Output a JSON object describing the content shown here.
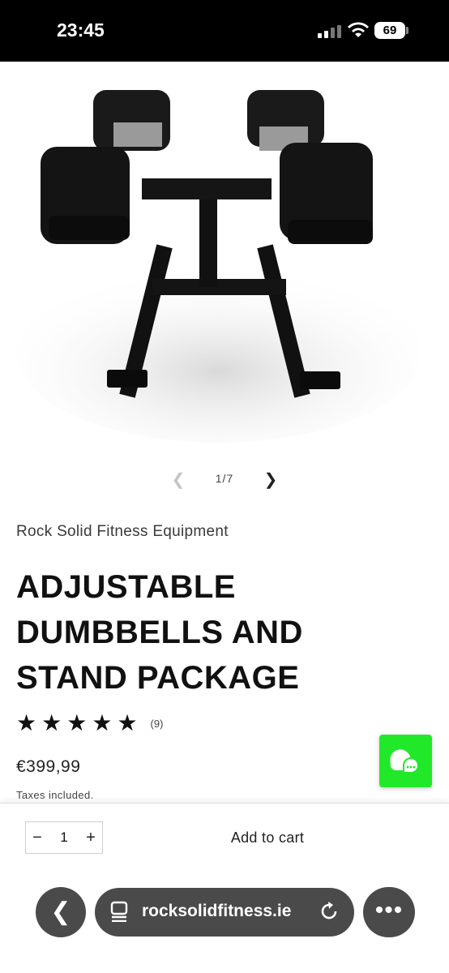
{
  "status_bar": {
    "time": "23:45",
    "battery_level": "69",
    "icons": [
      "signal-icon",
      "wifi-icon",
      "battery-icon"
    ]
  },
  "product": {
    "image_icon": "adjustable-dumbbells-on-stand-image",
    "gallery": {
      "counter": "1/7",
      "prev_icon": "chevron-left-icon",
      "next_icon": "chevron-right-icon"
    },
    "vendor": "Rock Solid Fitness Equipment",
    "title": "ADJUSTABLE DUMBBELLS AND STAND PACKAGE",
    "rating": {
      "stars": 5,
      "count": "(9)"
    },
    "price": "€399,99",
    "tax_note": "Taxes included."
  },
  "chat": {
    "icon": "chat-bubble-icon",
    "color": "#22e82a"
  },
  "buy_bar": {
    "quantity": "1",
    "minus_label": "−",
    "plus_label": "+",
    "add_to_cart": "Add to cart"
  },
  "browser": {
    "url": "rocksolidfitness.ie",
    "back_icon": "back-arrow-icon",
    "page_icon": "page-icon",
    "reload_icon": "reload-icon",
    "more_icon": "more-dots-icon"
  }
}
